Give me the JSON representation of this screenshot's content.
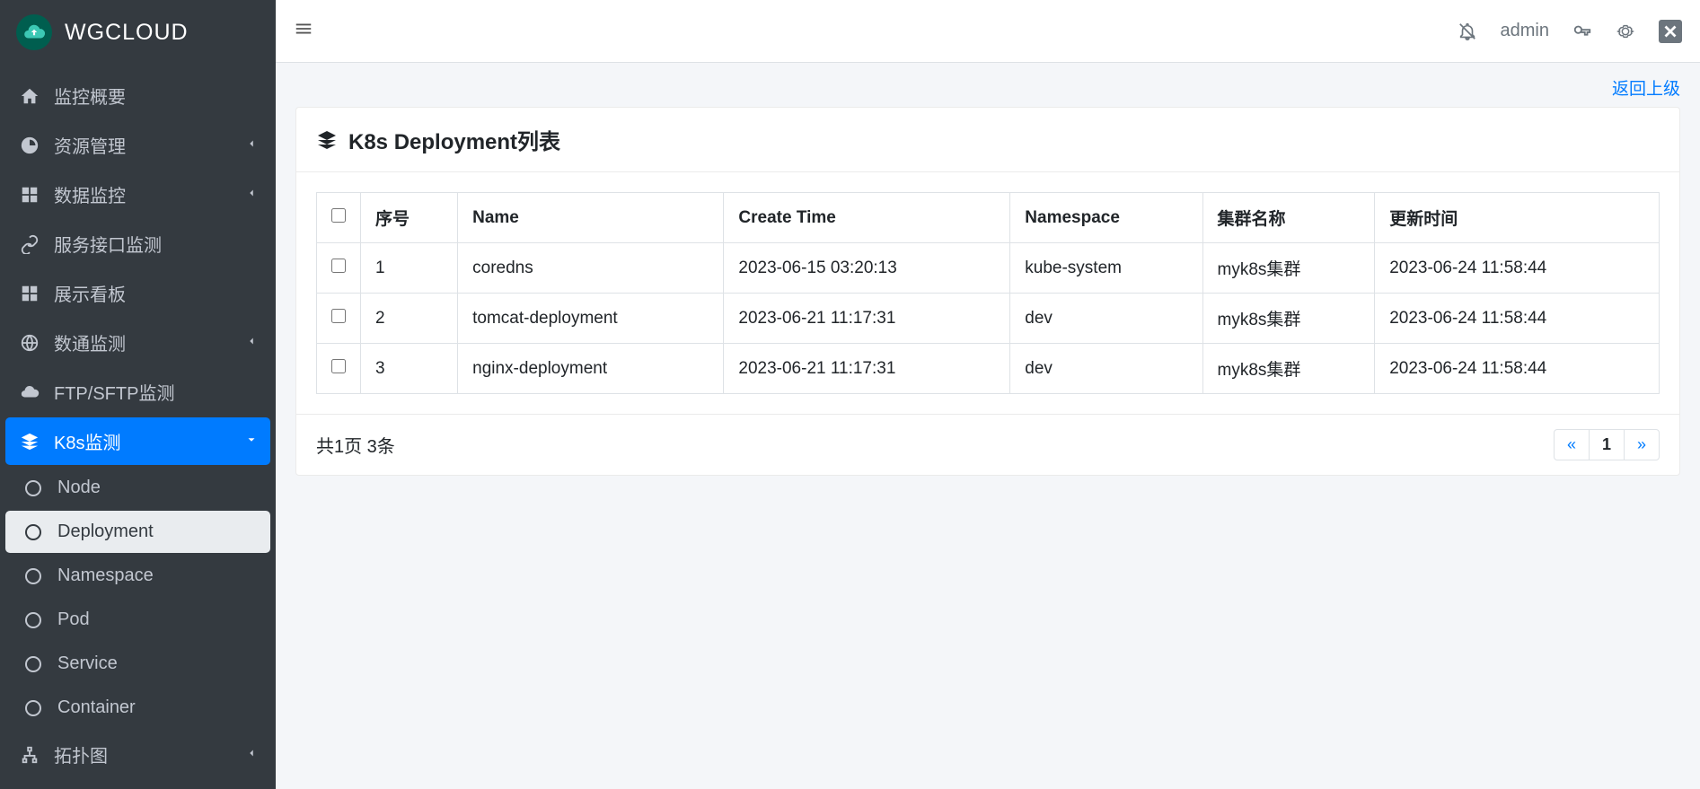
{
  "brand": {
    "name": "WGCLOUD"
  },
  "sidebar": {
    "items": [
      {
        "label": "监控概要",
        "icon": "home"
      },
      {
        "label": "资源管理",
        "icon": "dashboard",
        "chev": "left"
      },
      {
        "label": "数据监控",
        "icon": "grid",
        "chev": "left"
      },
      {
        "label": "服务接口监测",
        "icon": "link"
      },
      {
        "label": "展示看板",
        "icon": "grid"
      },
      {
        "label": "数通监测",
        "icon": "globe",
        "chev": "left"
      },
      {
        "label": "FTP/SFTP监测",
        "icon": "cloud"
      },
      {
        "label": "K8s监测",
        "icon": "layers",
        "chev": "down",
        "active": true
      },
      {
        "label": "拓扑图",
        "icon": "sitemap",
        "chev": "left"
      }
    ],
    "k8s_sub": [
      {
        "label": "Node"
      },
      {
        "label": "Deployment",
        "active": true
      },
      {
        "label": "Namespace"
      },
      {
        "label": "Pod"
      },
      {
        "label": "Service"
      },
      {
        "label": "Container"
      }
    ]
  },
  "topbar": {
    "user": "admin"
  },
  "page": {
    "back_label": "返回上级",
    "title": "K8s Deployment列表",
    "table": {
      "headers": [
        "序号",
        "Name",
        "Create Time",
        "Namespace",
        "集群名称",
        "更新时间"
      ],
      "rows": [
        {
          "idx": "1",
          "name": "coredns",
          "create": "2023-06-15 03:20:13",
          "ns": "kube-system",
          "cluster": "myk8s集群",
          "update": "2023-06-24 11:58:44"
        },
        {
          "idx": "2",
          "name": "tomcat-deployment",
          "create": "2023-06-21 11:17:31",
          "ns": "dev",
          "cluster": "myk8s集群",
          "update": "2023-06-24 11:58:44"
        },
        {
          "idx": "3",
          "name": "nginx-deployment",
          "create": "2023-06-21 11:17:31",
          "ns": "dev",
          "cluster": "myk8s集群",
          "update": "2023-06-24 11:58:44"
        }
      ]
    },
    "footer_text": "共1页 3条",
    "pagination": {
      "prev": "«",
      "current": "1",
      "next": "»"
    }
  }
}
